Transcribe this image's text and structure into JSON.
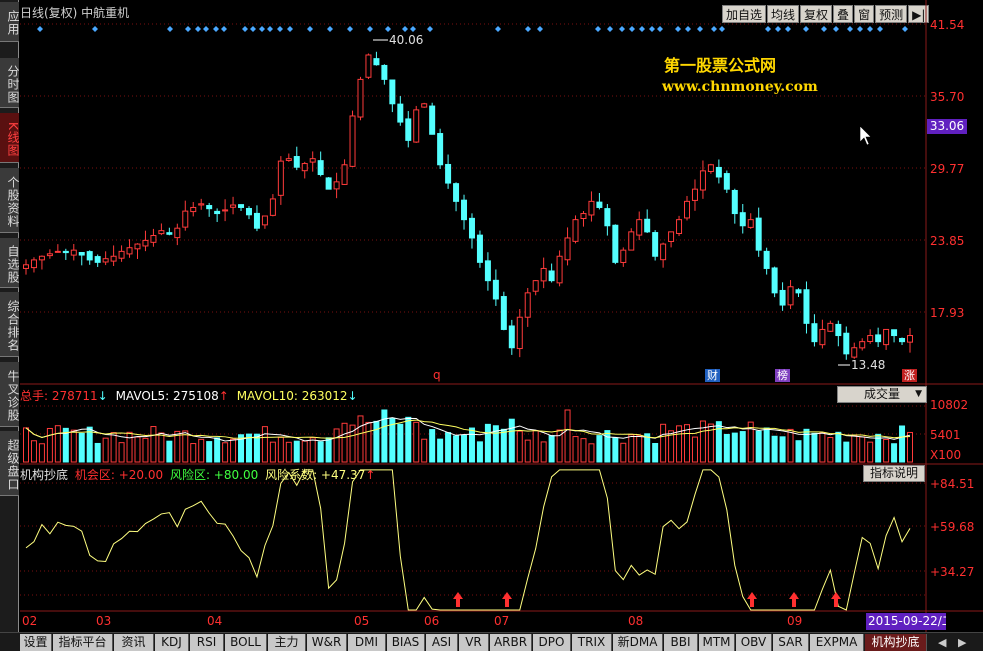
{
  "window": {
    "title": "日线(复权)  中航重机"
  },
  "left_tabs": [
    {
      "label": "应用",
      "active": false
    },
    {
      "label": "分时图",
      "active": false
    },
    {
      "label": "K线图",
      "active": true
    },
    {
      "label": "个股资料",
      "active": false
    },
    {
      "label": "自选股",
      "active": false
    },
    {
      "label": "综合排名",
      "active": false
    },
    {
      "label": "牛叉诊股",
      "active": false
    },
    {
      "label": "超级盘口",
      "active": false
    }
  ],
  "toolbar": {
    "add_watch": "加自选",
    "ma": "均线",
    "restore": "复权",
    "overlay": "叠",
    "window": "窗",
    "forecast": "预测",
    "nav": "▶|"
  },
  "watermark": {
    "line1": "第一股票公式网",
    "line2": "www.chnmoney.com"
  },
  "price_axis": [
    "41.54",
    "35.70",
    "29.77",
    "23.85",
    "17.93"
  ],
  "current_price": "33.06",
  "annotations": {
    "high": "40.06",
    "low": "13.48",
    "q": "q",
    "cai": "财",
    "bang": "榜",
    "zhang": "涨"
  },
  "volume_panel": {
    "total": "总手: 278711",
    "mavol5": "MAVOL5: 275108",
    "mavol10": "MAVOL10: 263012",
    "selector": "成交量",
    "axis": [
      "10802",
      "5401",
      "X100"
    ]
  },
  "indicator_panel": {
    "name": "机构抄底",
    "opportunity": "机会区: +20.00",
    "risk": "风险区: +80.00",
    "risk_coef": "风险系数: +47.37",
    "help": "指标说明",
    "axis": [
      "+84.51",
      "+59.68",
      "+34.27"
    ]
  },
  "x_axis": [
    "02",
    "03",
    "04",
    "05",
    "06",
    "07",
    "08",
    "09"
  ],
  "date_box": "2015-09-22/二",
  "bottom_tabs": [
    "设置",
    "指标平台",
    "资讯",
    "KDJ",
    "RSI",
    "BOLL",
    "主力",
    "W&R",
    "DMI",
    "BIAS",
    "ASI",
    "VR",
    "ARBR",
    "DPO",
    "TRIX",
    "新DMA",
    "BBI",
    "MTM",
    "OBV",
    "SAR",
    "EXPMA",
    "机构抄底"
  ],
  "active_bottom_tab": "机构抄底",
  "colors": {
    "up": "#ff3b3b",
    "down": "#54ffff",
    "diamond": "#4aa8ff",
    "indicator": "#ffff80"
  },
  "chart_data": {
    "type": "candlestick",
    "x_ticks": [
      "02",
      "03",
      "04",
      "05",
      "06",
      "07",
      "08",
      "09"
    ],
    "y_ticks": [
      41.54,
      35.7,
      29.77,
      23.85,
      17.93
    ],
    "ylim": [
      13.0,
      42.0
    ],
    "high": 40.06,
    "low": 13.48,
    "current": 33.06,
    "closes": [
      21.8,
      22.2,
      22.5,
      22.7,
      22.9,
      22.8,
      23.0,
      22.6,
      22.2,
      22.0,
      22.3,
      22.5,
      22.9,
      23.2,
      23.5,
      23.8,
      24.2,
      24.6,
      24.3,
      24.8,
      26.2,
      26.5,
      26.8,
      26.4,
      26.0,
      26.3,
      26.7,
      26.5,
      25.9,
      24.8,
      25.8,
      27.2,
      30.3,
      30.5,
      29.8,
      30.1,
      30.5,
      29.2,
      28.0,
      28.6,
      30.0,
      34.0,
      37.0,
      39.0,
      38.2,
      37.0,
      35.0,
      33.5,
      32.0,
      34.5,
      35.0,
      32.5,
      30.0,
      28.5,
      27.0,
      25.5,
      24.0,
      22.0,
      20.5,
      19.0,
      16.5,
      15.0,
      17.5,
      19.5,
      20.5,
      21.5,
      20.5,
      22.5,
      24.0,
      25.5,
      26.0,
      27.0,
      26.5,
      25.0,
      22.0,
      23.0,
      24.5,
      25.5,
      24.5,
      22.5,
      23.5,
      24.5,
      25.5,
      27.0,
      28.0,
      29.5,
      30.0,
      29.0,
      28.0,
      26.0,
      25.0,
      25.5,
      23.0,
      21.5,
      19.5,
      18.5,
      20.0,
      19.5,
      17.0,
      15.5,
      16.5,
      17.0,
      16.0,
      14.5,
      15.0,
      15.5,
      16.0,
      15.5,
      16.5,
      16.0,
      15.5,
      16.0
    ],
    "volume": {
      "ylim": [
        0,
        10802
      ],
      "y_ticks": [
        10802,
        5401
      ]
    },
    "indicator": {
      "name": "机构抄底",
      "ylim": [
        10,
        90
      ],
      "y_ticks": [
        84.51,
        59.68,
        34.27
      ],
      "opportunity": 20.0,
      "risk": 80.0,
      "risk_coef": 47.37
    }
  }
}
